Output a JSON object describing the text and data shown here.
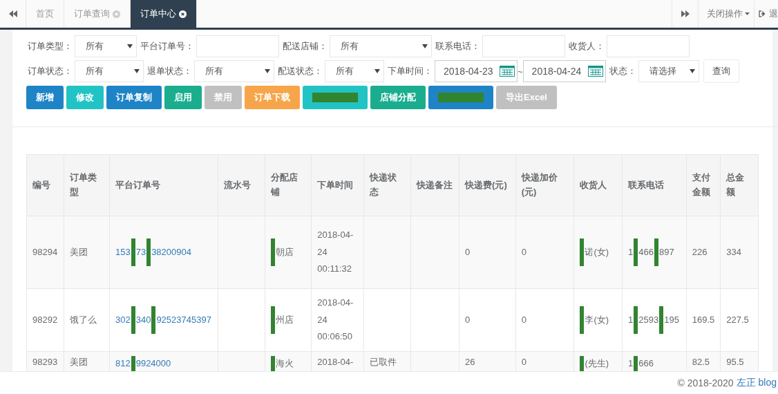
{
  "tabs": [
    {
      "label": "首页",
      "closable": false,
      "selected": false
    },
    {
      "label": "订单查询",
      "closable": true,
      "selected": false
    },
    {
      "label": "订单中心",
      "closable": true,
      "selected": true
    }
  ],
  "tab_actions": {
    "close_menu": "关闭操作",
    "logout": "退"
  },
  "filters": [
    [
      {
        "kind": "select",
        "label": "订单类型：",
        "value": "所有"
      },
      {
        "kind": "input",
        "label": "平台订单号："
      },
      {
        "kind": "select",
        "label": "配送店铺：",
        "value": "所有"
      },
      {
        "kind": "input",
        "label": "联系电话："
      },
      {
        "kind": "input",
        "label": "收货人："
      }
    ],
    [
      {
        "kind": "select",
        "label": "订单状态：",
        "value": "所有"
      },
      {
        "kind": "select",
        "label": "退单状态：",
        "value": "所有"
      },
      {
        "kind": "select",
        "label": "配送状态：",
        "value": "所有"
      },
      {
        "kind": "date",
        "label": "下单时间：",
        "value": "2018-04-23"
      },
      {
        "kind": "separator",
        "label": "~"
      },
      {
        "kind": "date",
        "value": "2018-04-24"
      },
      {
        "kind": "select",
        "label": "状态：",
        "value": "请选择"
      },
      {
        "kind": "button",
        "value": "查询"
      }
    ]
  ],
  "buttons": [
    {
      "label": "新增",
      "color": "#1e84c6"
    },
    {
      "label": "修改",
      "color": "#22c3c4"
    },
    {
      "label": "订单复制",
      "color": "#1e84c6"
    },
    {
      "label": "启用",
      "color": "#1aae8e"
    },
    {
      "label": "禁用",
      "color": "#c0c0c0"
    },
    {
      "label": "订单下载",
      "color": "#f7a54a"
    },
    {
      "redacted": true,
      "color": "#22c3c4"
    },
    {
      "label": "店铺分配",
      "color": "#1aae8e"
    },
    {
      "redacted": true,
      "color": "#1e84c6"
    },
    {
      "label": "导出Excel",
      "color": "#c0c0c0"
    }
  ],
  "table": {
    "columns": [
      {
        "label": "编号"
      },
      {
        "label": "订单类型"
      },
      {
        "label": "平台订单号",
        "kind": "link"
      },
      {
        "label": "流水号"
      },
      {
        "label": "分配店铺"
      },
      {
        "label": "下单时间"
      },
      {
        "label": "快递状态"
      },
      {
        "label": "快递备注"
      },
      {
        "label": "快递费(元)"
      },
      {
        "label": "快递加价(元)"
      },
      {
        "label": "收货人"
      },
      {
        "label": "联系电话"
      },
      {
        "label": "支付金额"
      },
      {
        "label": "总金额"
      }
    ],
    "rows": [
      [
        "98294",
        "美团",
        {
          "parts": [
            "153",
            "73",
            "38200904"
          ]
        },
        "",
        {
          "parts": [
            "朝店"
          ],
          "redacted_start": true
        },
        "2018-04-24 00:11:32",
        "",
        "",
        "0",
        "0",
        {
          "parts": [
            "诺(女)"
          ],
          "redacted_start": true
        },
        {
          "parts": [
            "1",
            "466",
            "897"
          ]
        },
        "226",
        "334"
      ],
      [
        "98292",
        "饿了么",
        {
          "parts": [
            "302",
            "340",
            "92523745397"
          ]
        },
        "",
        {
          "parts": [
            "州店"
          ],
          "redacted_start": true
        },
        "2018-04-24 00:06:50",
        "",
        "",
        "0",
        "0",
        {
          "parts": [
            "李(女)"
          ],
          "redacted_start": true
        },
        {
          "parts": [
            "1",
            "2593",
            "195"
          ]
        },
        "169.5",
        "227.5"
      ],
      [
        "98293",
        "美团",
        {
          "parts": [
            "812",
            "9924000"
          ]
        },
        "",
        {
          "parts": [
            "海火"
          ],
          "redacted_start": true
        },
        "2018-04-",
        "已取件",
        "",
        "26",
        "0",
        {
          "parts": [
            "(先生)"
          ],
          "redacted_start": true
        },
        {
          "parts": [
            "1",
            "666"
          ]
        },
        "82.5",
        "95.5"
      ]
    ]
  },
  "footer": {
    "text": "© 2018-2020",
    "link": "左正 blog"
  }
}
